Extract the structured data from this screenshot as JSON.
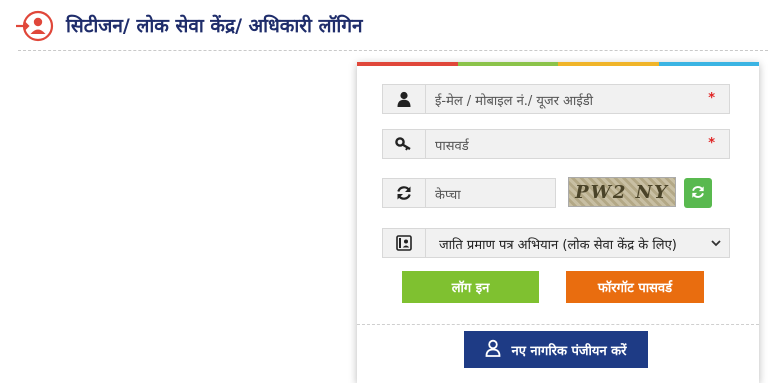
{
  "header": {
    "title": "सिटीजन/ लोक सेवा केंद्र/ अधिकारी लॉगिन",
    "icon": "user-login-icon"
  },
  "colors": {
    "title": "#1f2d6b",
    "bar": [
      "#e0473a",
      "#8bc34a",
      "#f0b429",
      "#3bb4e3"
    ],
    "login_button": "#7fc130",
    "forgot_button": "#e96d0f",
    "register_button": "#1e3b85",
    "refresh_button": "#59b94f"
  },
  "form": {
    "username": {
      "placeholder": "ई-मेल / मोबाइल नं./ यूजर आईडी",
      "required_mark": "*",
      "icon": "user-icon"
    },
    "password": {
      "placeholder": "पासवर्ड",
      "required_mark": "*",
      "icon": "key-icon"
    },
    "captcha": {
      "placeholder": "केप्चा",
      "image_text": "PW2 NY",
      "icon": "refresh-icon"
    },
    "login_type": {
      "selected": "जाति प्रमाण पत्र अभियान (लोक सेवा केंद्र के लिए)",
      "icon": "id-card-icon"
    }
  },
  "buttons": {
    "login": "लॉग इन",
    "forgot_password": "फॉरगॉट पासवर्ड",
    "register": "नए नागरिक पंजीयन करें"
  }
}
